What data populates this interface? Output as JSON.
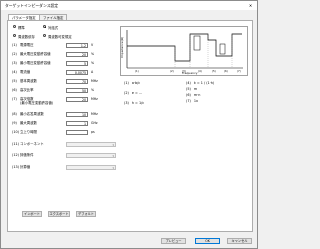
{
  "window": {
    "title": "ターゲットインピーダンス設定",
    "close_glyph": "✕"
  },
  "tabs": [
    {
      "label": "パラメータ指定"
    },
    {
      "label": "ファイル指定"
    }
  ],
  "mode": {
    "standard": "標準",
    "custom": "対話式",
    "frequency_dependent": "周波数依存",
    "frequency_dependent_alt": "周波数可変規定"
  },
  "fields": [
    {
      "idx": "(1)",
      "label": "電源電圧",
      "value": "1.2",
      "unit": "V"
    },
    {
      "idx": "(2)",
      "label": "最大電圧変動許容値",
      "value": "20",
      "unit": "%"
    },
    {
      "idx": "(3)",
      "label": "最小電圧変動許容値",
      "value": "5",
      "unit": "%"
    },
    {
      "idx": "(4)",
      "label": "電流値",
      "value": "0.0075",
      "unit": "A"
    },
    {
      "idx": "(5)",
      "label": "基本周波数",
      "value": "70",
      "unit": "MHz"
    },
    {
      "idx": "(6)",
      "label": "高次比率",
      "value": "50",
      "unit": "%"
    },
    {
      "idx": "(7)",
      "label": "高次倍数\n(最小電圧変動許容値)",
      "value": "20",
      "unit": "MHz"
    },
    {
      "idx": "(8)",
      "label": "最小応答周波数",
      "value": "10",
      "unit": "MHz"
    },
    {
      "idx": "(9)",
      "label": "最大周波数",
      "value": "1",
      "unit": "GHz"
    },
    {
      "idx": "(10)",
      "label": "立上り時間",
      "value": "",
      "unit": "ps"
    },
    {
      "idx": "(11)",
      "label": "コンポーネント",
      "value": "",
      "unit": ""
    },
    {
      "idx": "(12)",
      "label": "評価条件",
      "value": "",
      "unit": ""
    },
    {
      "idx": "(13)",
      "label": "計算値",
      "value": "",
      "unit": ""
    }
  ],
  "graph": {
    "ylabel": "Impedance(Ω)",
    "xlabel": "Frequency",
    "markers": [
      "(1)",
      "(2)",
      "(3)",
      "(4)",
      "(5)",
      "(6)",
      "(7)"
    ]
  },
  "formulas": [
    {
      "lhs": "(1)",
      "rhs": "a·b/c"
    },
    {
      "lhs": "(2)",
      "rhs": "e = ..."
    },
    {
      "lhs": "(3)",
      "rhs": "h = 1/c"
    },
    {
      "lhs": "(4)",
      "rhs": "k = 1 / (1·h)"
    },
    {
      "lhs": "(5)",
      "rhs": "m"
    },
    {
      "lhs": "(6)",
      "rhs": "m·n"
    },
    {
      "lhs": "(7)",
      "rhs": "1x"
    }
  ],
  "buttons": {
    "import": "インポート",
    "export": "エクスポート",
    "default": "デフォルト",
    "preview": "プレビュー",
    "ok": "OK",
    "cancel": "キャンセル"
  }
}
